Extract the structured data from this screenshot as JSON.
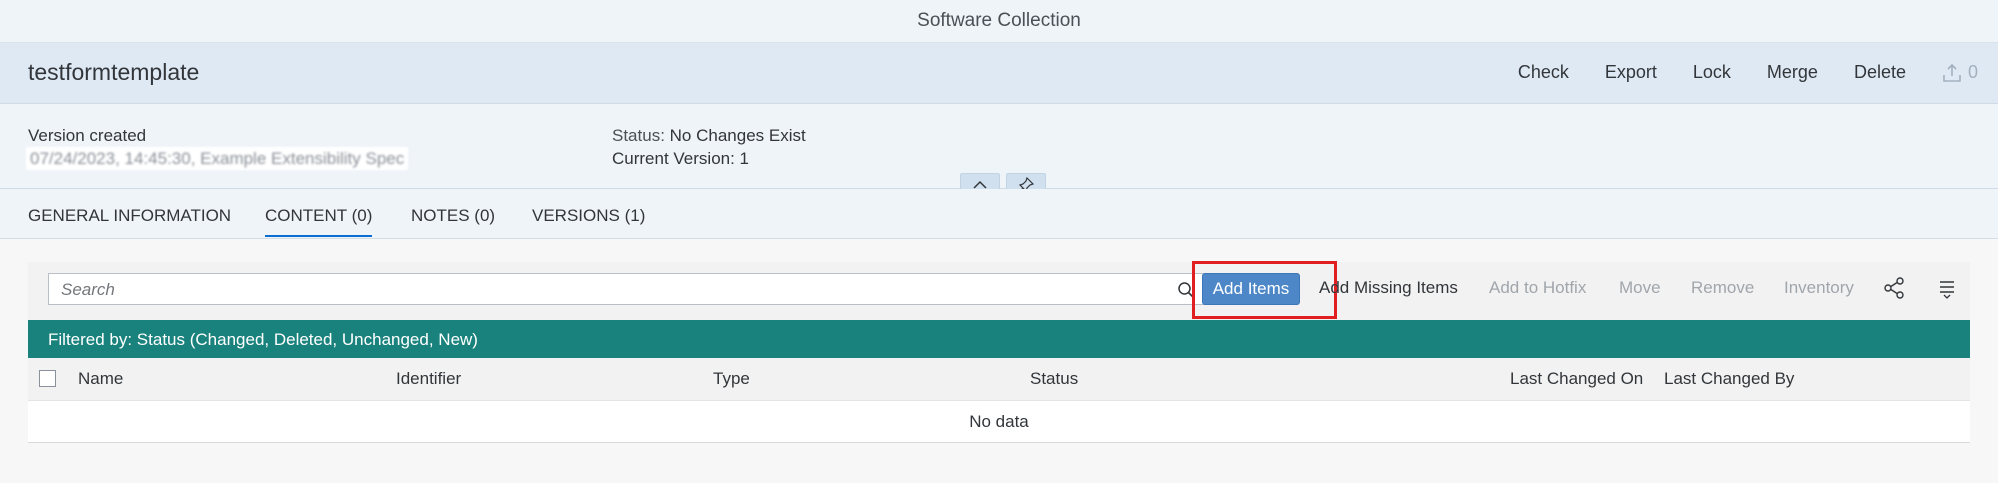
{
  "shell": {
    "title": "Software Collection"
  },
  "header": {
    "object_title": "testformtemplate",
    "actions": [
      "Check",
      "Export",
      "Lock",
      "Merge",
      "Delete"
    ],
    "upload_count": "0"
  },
  "header_content": {
    "created_label": "Version created",
    "created_value": "07/24/2023, 14:45:30, Example Extensibility Spec",
    "status_label": "Status:",
    "status_value": "No Changes Exist",
    "current_version": "Current Version: 1"
  },
  "tabs": [
    {
      "label": "GENERAL INFORMATION",
      "active": false
    },
    {
      "label": "CONTENT (0)",
      "active": true
    },
    {
      "label": "NOTES (0)",
      "active": false
    },
    {
      "label": "VERSIONS (1)",
      "active": false
    }
  ],
  "toolbar": {
    "search_placeholder": "Search",
    "add_items": "Add Items",
    "add_missing_items": "Add Missing Items",
    "add_to_hotfix": "Add to Hotfix",
    "move": "Move",
    "remove": "Remove",
    "inventory": "Inventory"
  },
  "filter": {
    "text": "Filtered by: Status (Changed, Deleted, Unchanged, New)"
  },
  "table": {
    "columns": [
      "Name",
      "Identifier",
      "Type",
      "Status",
      "Last Changed On",
      "Last Changed By"
    ],
    "empty_text": "No data"
  },
  "colors": {
    "accent": "#0a6ed1",
    "primary_button": "#4d87c7",
    "filter_bar": "#19827d",
    "highlight": "#e02020"
  }
}
